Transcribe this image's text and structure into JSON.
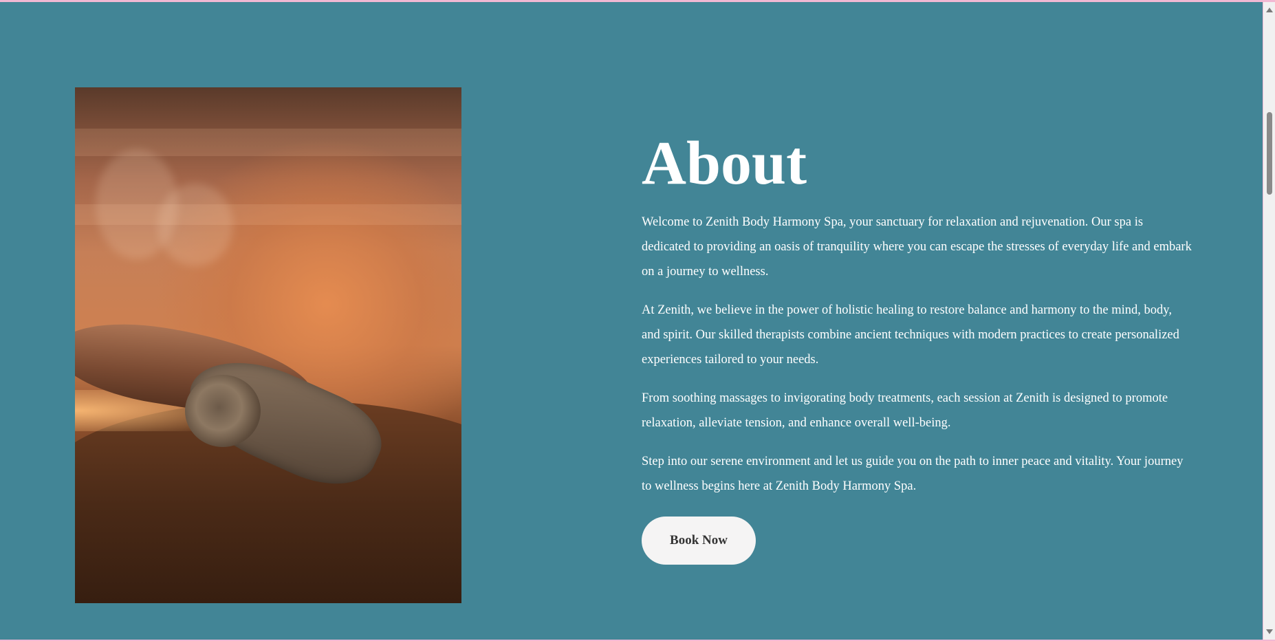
{
  "about": {
    "heading": "About",
    "paragraphs": [
      "Welcome to Zenith Body Harmony Spa, your sanctuary for relaxation and rejuvenation. Our spa is dedicated to providing an oasis of tranquility where you can escape the stresses of everyday life and embark on a journey to wellness.",
      "At Zenith, we believe in the power of holistic healing to restore balance and harmony to the mind, body, and spirit. Our skilled therapists combine ancient techniques with modern practices to create personalized experiences tailored to your needs.",
      "From soothing massages to invigorating body treatments, each session at Zenith is designed to promote relaxation, alleviate tension, and enhance overall well-being.",
      "Step into our serene environment and let us guide you on the path to inner peace and vitality. Your journey to wellness begins here at Zenith Body Harmony Spa."
    ],
    "button_label": "Book Now"
  },
  "colors": {
    "section_background": "#428596",
    "button_background": "#f5f4f4",
    "text": "#ffffff"
  },
  "icons": {
    "scroll_up": "scroll-up-arrow-icon",
    "scroll_down": "scroll-down-arrow-icon"
  }
}
